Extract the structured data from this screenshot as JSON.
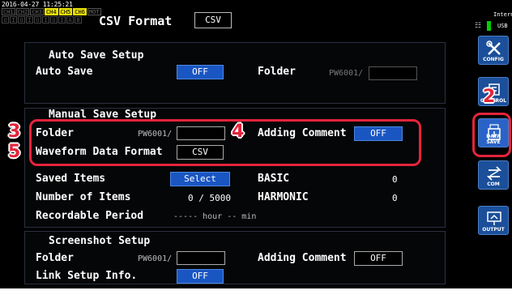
{
  "header": {
    "timestamp": "2016-04-27 11:25:21",
    "channels": [
      {
        "label": "CH1",
        "active": false
      },
      {
        "label": "CH2",
        "active": false
      },
      {
        "label": "CH3",
        "active": false
      },
      {
        "label": "CH4",
        "active": true
      },
      {
        "label": "CH5",
        "active": true
      },
      {
        "label": "CH6",
        "active": false
      },
      {
        "label": "MOT",
        "active": false
      }
    ],
    "current_ranges": [
      "U",
      "I",
      "U",
      "I",
      "U",
      "I",
      "U",
      "I",
      "A",
      "B"
    ],
    "title": "CSV Format",
    "format_value": "CSV"
  },
  "storage": {
    "internal_label": "Internal",
    "usb_label": "USB",
    "usb_connected": true
  },
  "sidebar": {
    "items": [
      {
        "label": "CONFIG",
        "icon": "wrench-screwdriver-icon",
        "active": false
      },
      {
        "label": "CONTROL",
        "icon": "control-icon",
        "active": false
      },
      {
        "label": "DATA SAVE",
        "icon": "usb-save-icon",
        "active": true
      },
      {
        "label": "COM",
        "icon": "com-arrows-icon",
        "active": false
      },
      {
        "label": "OUTPUT",
        "icon": "output-icon",
        "active": false
      }
    ]
  },
  "auto_save": {
    "title": "Auto Save Setup",
    "auto_save_label": "Auto Save",
    "auto_save_value": "OFF",
    "folder_label": "Folder",
    "folder_value": "PW6001/"
  },
  "manual_save": {
    "title": "Manual Save Setup",
    "folder_label": "Folder",
    "folder_value": "PW6001/",
    "adding_comment_label": "Adding Comment",
    "adding_comment_value": "OFF",
    "waveform_label": "Waveform Data Format",
    "waveform_value": "CSV",
    "saved_items_label": "Saved Items",
    "saved_items_button": "Select",
    "basic_label": "BASIC",
    "basic_value": "0",
    "number_items_label": "Number of Items",
    "number_items_value": "0 / 5000",
    "harmonic_label": "HARMONIC",
    "harmonic_value": "0",
    "recordable_label": "Recordable Period",
    "recordable_value": "----- hour -- min"
  },
  "screenshot": {
    "title": "Screenshot Setup",
    "folder_label": "Folder",
    "folder_value": "PW6001/",
    "adding_comment_label": "Adding Comment",
    "adding_comment_value": "OFF",
    "link_label": "Link Setup Info.",
    "link_value": "OFF"
  },
  "annotations": {
    "n2": "2",
    "n3": "3",
    "n4": "4",
    "n5": "5"
  },
  "colors": {
    "accent_blue": "#1a56c2",
    "callout_red": "#e5243b",
    "usb_green": "#00d000",
    "channel_yellow": "#e8e000"
  }
}
